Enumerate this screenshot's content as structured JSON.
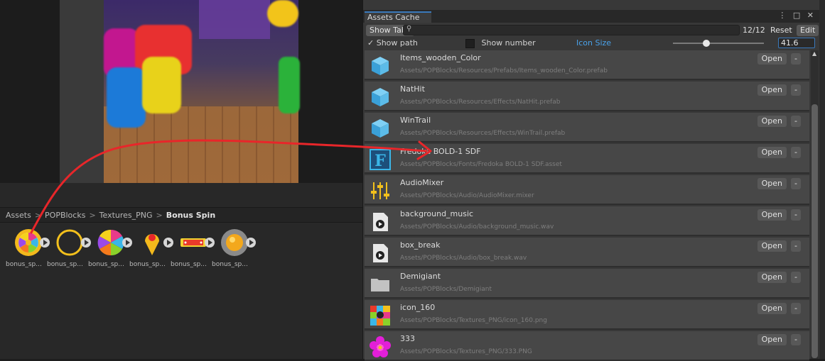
{
  "scene_view": {},
  "project": {
    "breadcrumb": [
      "Assets",
      "POPBlocks",
      "Textures_PNG",
      "Bonus Spin"
    ],
    "thumbnails": [
      {
        "label": "bonus_sp...",
        "icon": "spin-wheel-icon"
      },
      {
        "label": "bonus_sp...",
        "icon": "ring-icon"
      },
      {
        "label": "bonus_sp...",
        "icon": "color-wheel-icon"
      },
      {
        "label": "bonus_sp...",
        "icon": "pointer-icon"
      },
      {
        "label": "bonus_sp...",
        "icon": "banner-icon"
      },
      {
        "label": "bonus_sp...",
        "icon": "orb-icon"
      }
    ]
  },
  "cache": {
    "tab_title": "Assets Cache",
    "window_controls": "⋮ □ ✕",
    "show_tabs_label": "Show Tabs",
    "search_value": "",
    "count": "12/12",
    "reset_label": "Reset",
    "edit_label": "Edit",
    "show_path_label": "Show path",
    "show_path_checked": true,
    "show_number_label": "Show number",
    "show_number_checked": false,
    "icon_size_label": "Icon Size",
    "icon_size_value": "41.6",
    "open_label": "Open",
    "remove_label": "-",
    "items": [
      {
        "name": "Items_wooden_Color",
        "path": "Assets/POPBlocks/Resources/Prefabs/Items_wooden_Color.prefab",
        "icon": "prefab-cube-icon"
      },
      {
        "name": "NatHit",
        "path": "Assets/POPBlocks/Resources/Effects/NatHit.prefab",
        "icon": "prefab-cube-icon"
      },
      {
        "name": "WinTrail",
        "path": "Assets/POPBlocks/Resources/Effects/WinTrail.prefab",
        "icon": "prefab-cube-icon"
      },
      {
        "name": "Fredoka  BOLD-1 SDF",
        "path": "Assets/POPBlocks/Fonts/Fredoka  BOLD-1 SDF.asset",
        "icon": "font-asset-icon"
      },
      {
        "name": "AudioMixer",
        "path": "Assets/POPBlocks/Audio/AudioMixer.mixer",
        "icon": "audio-mixer-icon"
      },
      {
        "name": "background_music",
        "path": "Assets/POPBlocks/Audio/background_music.wav",
        "icon": "audio-clip-icon"
      },
      {
        "name": "box_break",
        "path": "Assets/POPBlocks/Audio/box_break.wav",
        "icon": "audio-clip-icon"
      },
      {
        "name": "Demigiant",
        "path": "Assets/POPBlocks/Demigiant",
        "icon": "folder-icon"
      },
      {
        "name": "icon_160",
        "path": "Assets/POPBlocks/Textures_PNG/icon_160.png",
        "icon": "texture-thumbnail-icon"
      },
      {
        "name": "333",
        "path": "Assets/POPBlocks/Textures_PNG/333.PNG",
        "icon": "flower-texture-icon"
      }
    ]
  },
  "colors": {
    "accent": "#3a79bb",
    "annotation_arrow": "#e8262a",
    "icon_size_label": "#4aa2ea"
  }
}
